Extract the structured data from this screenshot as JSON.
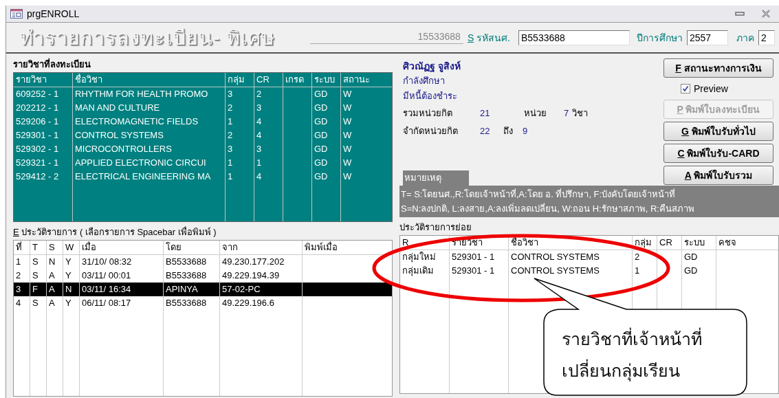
{
  "window": {
    "title": "prgENROLL"
  },
  "header": {
    "title": "ทำรายการลงทะเบียน- พิเศษ",
    "ref_number": "15533688",
    "student_id_key": "S",
    "student_id_label": "รหัสนศ.",
    "student_id": "B5533688",
    "year_label": "ปีการศึกษา",
    "year": "2557",
    "term_label": "ภาค",
    "term": "2"
  },
  "enrolled": {
    "title": "รายวิชาที่ลงทะเบียน",
    "columns": [
      "รายวิชา",
      "ชื่อวิชา",
      "กลุ่ม",
      "CR",
      "เกรด",
      "ระบบ",
      "สถานะ"
    ],
    "rows": [
      [
        "609252 - 1",
        "RHYTHM FOR HEALTH PROMO",
        "3",
        "2",
        "",
        "GD",
        "W"
      ],
      [
        "202212 - 1",
        "MAN AND CULTURE",
        "2",
        "3",
        "",
        "GD",
        "W"
      ],
      [
        "529206 - 1",
        "ELECTROMAGNETIC FIELDS",
        "1",
        "4",
        "",
        "GD",
        "W"
      ],
      [
        "529301 - 1",
        "CONTROL SYSTEMS",
        "2",
        "4",
        "",
        "GD",
        "W"
      ],
      [
        "529302 - 1",
        "MICROCONTROLLERS",
        "3",
        "3",
        "",
        "GD",
        "W"
      ],
      [
        "529321 - 1",
        "APPLIED ELECTRONIC CIRCUI",
        "1",
        "1",
        "",
        "GD",
        "W"
      ],
      [
        "529412 - 2",
        "ELECTRICAL ENGINEERING MA",
        "1",
        "4",
        "",
        "GD",
        "W"
      ]
    ]
  },
  "student": {
    "name": "ศิวณัฏฐ จูสิงห์",
    "status": "กำลังศึกษา",
    "debt": "มีหนี้ต้องชำระ",
    "credits_label": "รวมหน่วยกิต",
    "credits": "21",
    "credits_unit": "หน่วย",
    "courses": "7",
    "courses_unit": "วิชา",
    "limit_label": "จำกัดหน่วยกิต",
    "limit_min": "22",
    "limit_to": "ถึง",
    "limit_max": "9"
  },
  "buttons": [
    {
      "key": "F",
      "label": "สถานะทางการเงิน",
      "disabled": false
    },
    {
      "key": "P",
      "label": "พิมพ์ใบลงทะเบียน",
      "disabled": true
    },
    {
      "key": "G",
      "label": "พิมพ์ใบรับทั่วไป",
      "disabled": false
    },
    {
      "key": "C",
      "label": "พิมพ์ใบรับ-CARD",
      "disabled": false
    },
    {
      "key": "A",
      "label": "พิมพ์ใบรับรวม",
      "disabled": false
    }
  ],
  "preview": {
    "label": "Preview",
    "checked": true
  },
  "note": {
    "title": "หมายเหตุ",
    "lines": [
      "T= S:โดยนศ.,R:โดยเจ้าหน้าที่,A:โดย อ. ที่ปรึกษา, F:บังคับโดยเจ้าหน้าที่",
      "S=N:ลงปกติ, L:ลงสาย,A:ลงเพิ่มลดเปลี่ยน, W:ถอน H:รักษาสภาพ, R:คืนสภาพ"
    ]
  },
  "history": {
    "key": "E",
    "title": "ประวัติรายการ ( เลือกรายการ Spacebar เพื่อพิมพ์ )",
    "columns": [
      "ที่",
      "T",
      "S",
      "W",
      "เมื่อ",
      "โดย",
      "จาก",
      "พิมพ์เมื่อ"
    ],
    "rows": [
      {
        "cells": [
          "1",
          "S",
          "N",
          "Y",
          "31/10/ 08:32",
          "B5533688",
          "49.230.177.202",
          ""
        ],
        "selected": false
      },
      {
        "cells": [
          "2",
          "S",
          "A",
          "Y",
          "03/11/ 00:01",
          "B5533688",
          "49.229.194.39",
          ""
        ],
        "selected": false
      },
      {
        "cells": [
          "3",
          "F",
          "A",
          "N",
          "03/11/ 16:34",
          "APINYA",
          "57-02-PC",
          ""
        ],
        "selected": true
      },
      {
        "cells": [
          "4",
          "S",
          "A",
          "Y",
          "06/11/ 08:17",
          "B5533688",
          "49.229.196.6",
          ""
        ],
        "selected": false
      }
    ]
  },
  "sub_history": {
    "title": "ประวัติรายการย่อย",
    "columns": [
      "R",
      "รายวิชา",
      "ชื่อวิชา",
      "กลุ่ม",
      "CR",
      "ระบบ",
      "คชจ"
    ],
    "rows": [
      [
        "กลุ่มใหม่",
        "529301 - 1",
        "CONTROL SYSTEMS",
        "2",
        "",
        "GD",
        ""
      ],
      [
        "กลุ่มเดิม",
        "529301 - 1",
        "CONTROL SYSTEMS",
        "1",
        "",
        "GD",
        ""
      ]
    ]
  },
  "annotation": {
    "lines": [
      "รายวิชาที่เจ้าหน้าที่",
      "เปลี่ยนกลุ่มเรียน"
    ]
  }
}
